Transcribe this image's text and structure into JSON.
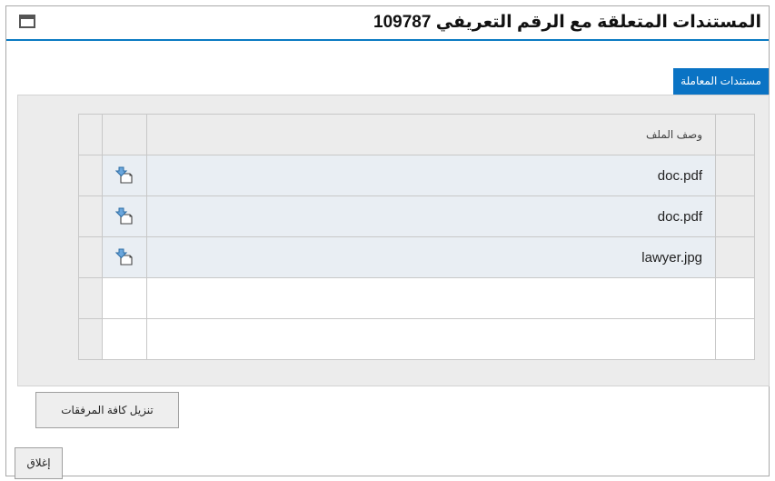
{
  "window": {
    "title": "المستندات المتعلقة مع الرقم التعريفي 109787"
  },
  "tab": {
    "label": "مستندات المعاملة"
  },
  "table": {
    "header": "وصف الملف",
    "rows": [
      {
        "file": "doc.pdf",
        "action_icon": "download-file-icon"
      },
      {
        "file": "doc.pdf",
        "action_icon": "download-file-icon"
      },
      {
        "file": "lawyer.jpg",
        "action_icon": "download-file-icon"
      }
    ],
    "empty_rows": 2
  },
  "buttons": {
    "download_all": "تنزيل كافة المرفقات",
    "close": "إغلاق"
  },
  "colors": {
    "accent": "#0b7ac2",
    "tab_bg": "#0a73c4",
    "panel_bg": "#ececec",
    "row_bg": "#e9eef3"
  }
}
